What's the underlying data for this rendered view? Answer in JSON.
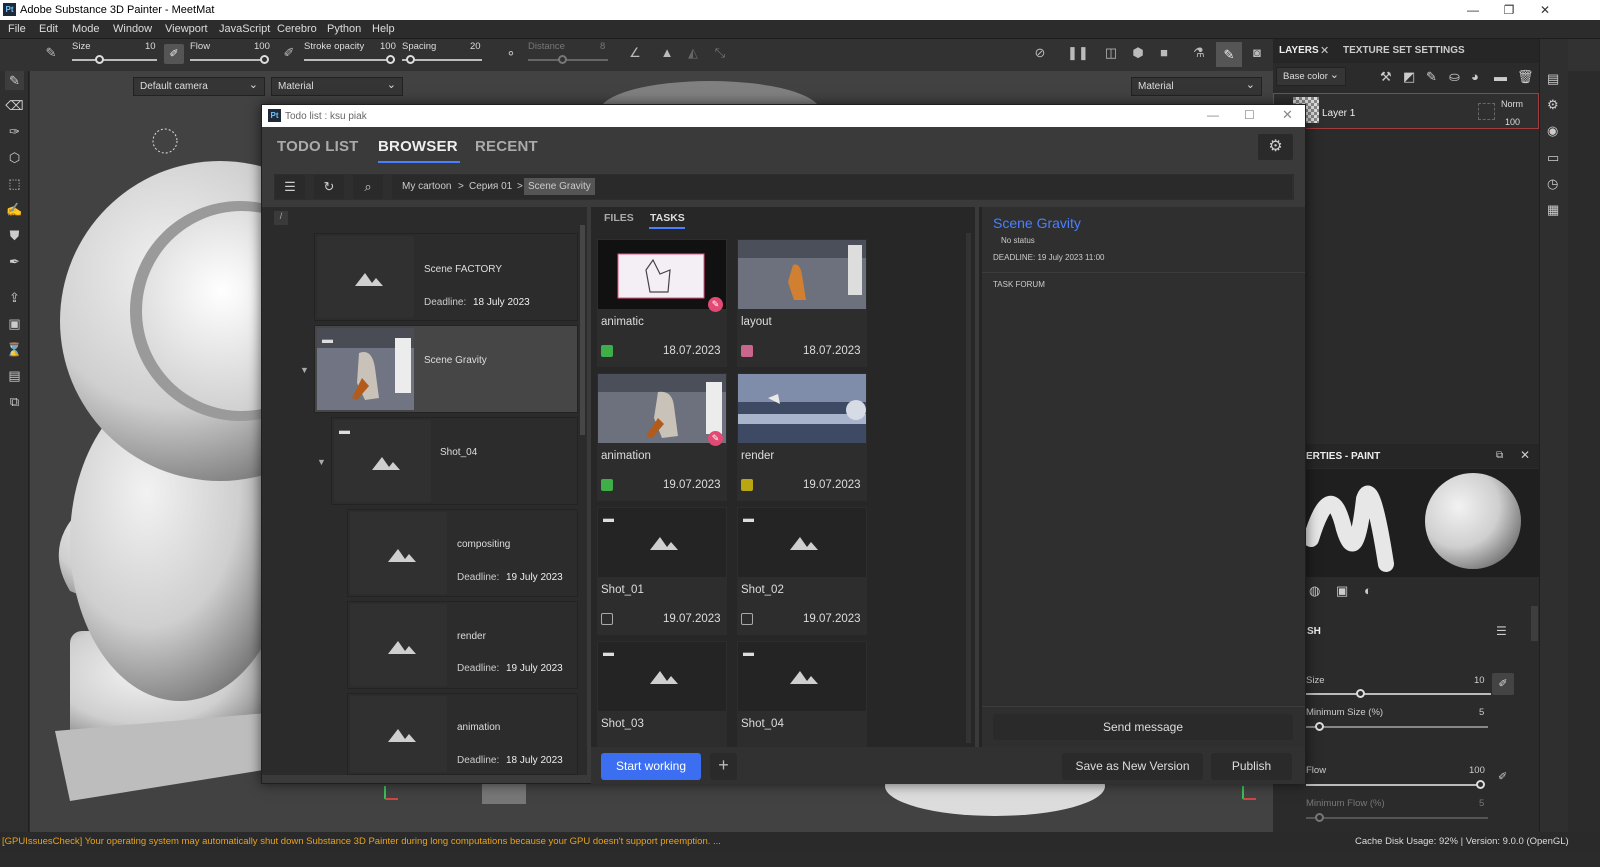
{
  "window": {
    "title": "Adobe Substance 3D Painter - MeetMat",
    "logo": "Pt"
  },
  "menu": [
    "File",
    "Edit",
    "Mode",
    "Window",
    "Viewport",
    "JavaScript",
    "Cerebro",
    "Python",
    "Help"
  ],
  "toolbar": {
    "size_label": "Size",
    "size_value": "10",
    "flow_label": "Flow",
    "flow_value": "100",
    "stroke_label": "Stroke opacity",
    "stroke_value": "100",
    "spacing_label": "Spacing",
    "spacing_value": "20",
    "distance_label": "Distance",
    "distance_value": "8"
  },
  "viewport": {
    "camera": "Default camera",
    "mode_left": "Material",
    "mode_right": "Material"
  },
  "layers_panel": {
    "tab_layers": "LAYERS",
    "tab_texture": "TEXTURE SET SETTINGS",
    "channel": "Base color",
    "layer_name": "Layer 1",
    "blend": "Norm",
    "opacity": "100"
  },
  "properties_panel": {
    "title": "ERTIES - PAINT",
    "section": "SH",
    "size_label": "Size",
    "size_value": "10",
    "min_size_label": "Minimum Size (%)",
    "min_size_value": "5",
    "flow_label": "Flow",
    "flow_value": "100",
    "min_flow_label": "Minimum Flow (%)",
    "min_flow_value": "5"
  },
  "status": {
    "warning": "[GPUIssuesCheck] Your operating system may automatically shut down Substance 3D Painter during long computations because your GPU doesn't support preemption. ...",
    "right": "Cache Disk Usage:    92% | Version: 9.0.0 (OpenGL)"
  },
  "dialog": {
    "logo": "Pt",
    "title": "Todo list : ksu piak",
    "tabs": [
      "TODO LIST",
      "BROWSER",
      "RECENT"
    ],
    "breadcrumb": [
      "My cartoon",
      "Серия 01",
      "Scene Gravity"
    ],
    "tree_path": "/",
    "tree": [
      {
        "name": "Scene FACTORY",
        "deadline_label": "Deadline:",
        "deadline": "18 July 2023"
      },
      {
        "name": "Scene Gravity"
      },
      {
        "name": "Shot_04"
      },
      {
        "name": "compositing",
        "deadline_label": "Deadline:",
        "deadline": "19 July 2023"
      },
      {
        "name": "render",
        "deadline_label": "Deadline:",
        "deadline": "19 July 2023"
      },
      {
        "name": "animation",
        "deadline_label": "Deadline:",
        "deadline": "18 July 2023"
      }
    ],
    "subtabs": [
      "FILES",
      "TASKS"
    ],
    "tasks": [
      {
        "name": "animatic",
        "date": "18.07.2023",
        "status_color": "#3fae49"
      },
      {
        "name": "layout",
        "date": "18.07.2023",
        "status_color": "#c9668e"
      },
      {
        "name": "animation",
        "date": "19.07.2023",
        "status_color": "#3fae49"
      },
      {
        "name": "render",
        "date": "19.07.2023",
        "status_color": "#b8a711"
      },
      {
        "name": "Shot_01",
        "date": "19.07.2023"
      },
      {
        "name": "Shot_02",
        "date": "19.07.2023"
      },
      {
        "name": "Shot_03",
        "date": ""
      },
      {
        "name": "Shot_04",
        "date": ""
      }
    ],
    "detail": {
      "title": "Scene Gravity",
      "status": "No status",
      "deadline": "DEADLINE: 19 July 2023 11:00",
      "forum": "TASK FORUM",
      "send": "Send message"
    },
    "buttons": {
      "start": "Start working",
      "add": "+",
      "save_version": "Save as New Version",
      "publish": "Publish"
    }
  }
}
